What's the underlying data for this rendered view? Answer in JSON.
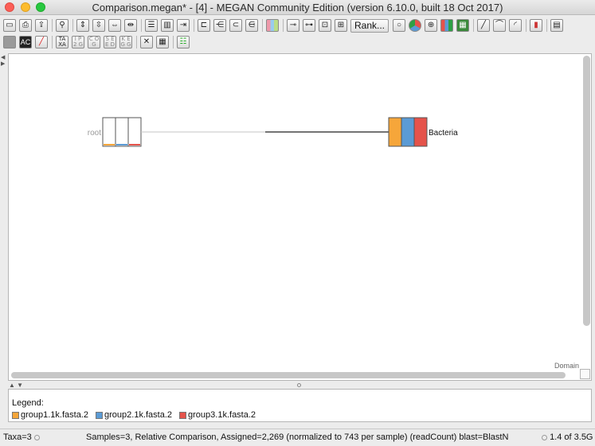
{
  "window": {
    "title": "Comparison.megan* - [4] - MEGAN Community Edition (version 6.10.0, built 18 Oct 2017)"
  },
  "toolbar": {
    "rank_label": "Rank...",
    "taxa_icon_text": "TA XA",
    "ip_icon_text": "I P 2 G",
    "cog_icon_text": "C O G",
    "seed_icon_text": "S E E D",
    "kegg_icon_text": "K E G G",
    "ac_icon_text": "AC"
  },
  "tree": {
    "root_label": "root",
    "child_label": "Bacteria",
    "rank_footer": "Domain",
    "root_bar_fractions": [
      0.1,
      0.1,
      0.1
    ],
    "child_bar_fractions": [
      1.0,
      1.0,
      1.0
    ]
  },
  "legend": {
    "title": "Legend:",
    "items": [
      {
        "label": "group1.1k.fasta.2",
        "color": "#f6a63a"
      },
      {
        "label": "group2.1k.fasta.2",
        "color": "#5b9bd5"
      },
      {
        "label": "group3.1k.fasta.2",
        "color": "#e5534b"
      }
    ]
  },
  "status": {
    "taxa": "Taxa=3",
    "summary": "Samples=3, Relative Comparison, Assigned=2,269 (normalized to 743 per sample) (readCount) blast=BlastN",
    "memory": "1.4 of 3.5G"
  }
}
